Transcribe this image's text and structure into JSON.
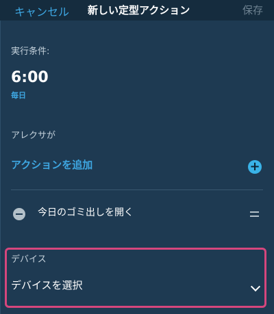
{
  "header": {
    "cancel_label": "キャンセル",
    "title": "新しい定型アクション",
    "save_label": "保存"
  },
  "trigger": {
    "section_label": "実行条件:",
    "time": "6:00",
    "frequency": "毎日"
  },
  "actions": {
    "section_label": "アレクサが",
    "add_label": "アクションを追加",
    "add_icon": "plus-circle-icon",
    "items": [
      {
        "label": "今日のゴミ出しを開く",
        "remove_icon": "minus-circle-icon",
        "handle_icon": "drag-handle-icon"
      }
    ]
  },
  "device": {
    "section_label": "デバイス",
    "select_label": "デバイスを選択",
    "chevron_icon": "chevron-down-icon",
    "highlight_color": "#d6467d"
  },
  "colors": {
    "background": "#1e3a52",
    "header_background": "#152c3e",
    "accent": "#3ea7e2",
    "text": "#ffffff",
    "muted_text": "#c4d1db"
  }
}
